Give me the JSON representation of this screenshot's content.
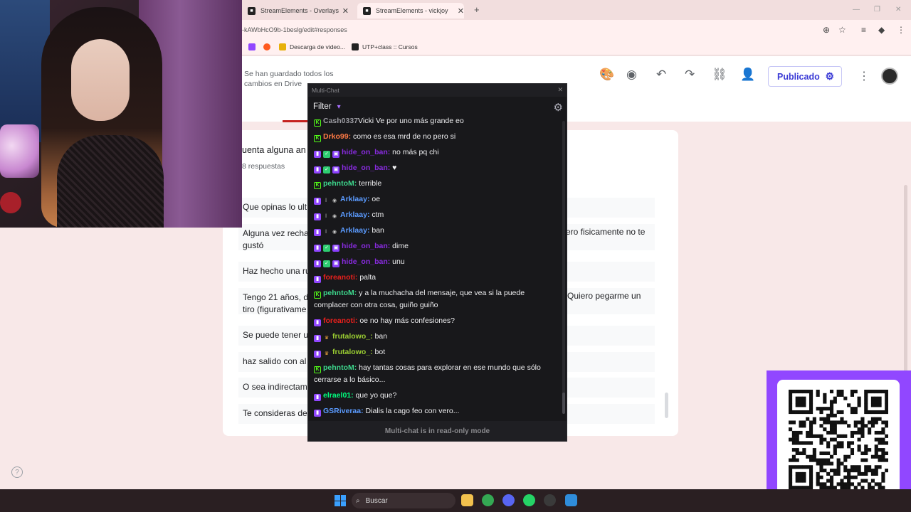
{
  "browser": {
    "tabs": [
      {
        "title": "StreamElements - Overlays"
      },
      {
        "title": "StreamElements - vickjoy"
      }
    ],
    "new_tab_symbol": "+",
    "url": "-kAWbHcO9b-1beslg/edit#responses",
    "bookmarks": [
      {
        "label": "",
        "icon": "twitch-icon",
        "color": "#9147ff"
      },
      {
        "label": "",
        "icon": "chrome-icon",
        "color": "#ff5a1f"
      },
      {
        "label": "Descarga de video...",
        "icon": "v-icon",
        "color": "#e7b10a"
      },
      {
        "label": "UTP+class :: Cursos",
        "icon": "utp-icon",
        "color": "#222222"
      }
    ]
  },
  "forms": {
    "saved_status": "Se han guardado todos los cambios en Drive",
    "publish_label": "Publicado",
    "question_title": "uenta alguna an",
    "responses_count": "8 respuestas",
    "responses": [
      {
        "left": "Que opinas lo ult",
        "right": ""
      },
      {
        "left": "Alguna vez recha",
        "right": "ero fisicamente no te",
        "continuation": "gustó"
      },
      {
        "left": "Haz hecho una ru",
        "right": ""
      },
      {
        "left": "Tengo 21 años, d",
        "right": "Quiero pegarme un",
        "continuation": "tiro (figurativame"
      },
      {
        "left": "Se puede tener u",
        "right": ""
      },
      {
        "left": "haz salido con al",
        "right": ""
      },
      {
        "left": "O sea indirectam",
        "right": ""
      },
      {
        "left": "Te consideras de",
        "right": ""
      }
    ]
  },
  "multichat": {
    "window_title": "Multi-Chat",
    "filter_label": "Filter",
    "footer": "Multi-chat is in read-only mode",
    "messages": [
      {
        "platform": "kick",
        "badges": [],
        "user": "Cash0337",
        "user_color": "#9a9aa0",
        "text": "Vicki Ve por uno más grande eo"
      },
      {
        "platform": "kick",
        "badges": [],
        "user": "Drko99:",
        "user_color": "#ff7a45",
        "text": " como es esa mrd de no pero si"
      },
      {
        "platform": "twitch",
        "badges": [
          "green",
          "purple"
        ],
        "user": "hide_on_ban:",
        "user_color": "#8a2be2",
        "text": " no más pq chi"
      },
      {
        "platform": "twitch",
        "badges": [
          "green",
          "purple"
        ],
        "user": "hide_on_ban:",
        "user_color": "#8a2be2",
        "text": " ♥"
      },
      {
        "platform": "kick",
        "badges": [],
        "user": "pehntoM:",
        "user_color": "#3dd68c",
        "text": " terrible"
      },
      {
        "platform": "twitch",
        "badges": [
          "sword",
          "bot"
        ],
        "user": "Arklaay:",
        "user_color": "#5b9bff",
        "text": " oe"
      },
      {
        "platform": "twitch",
        "badges": [
          "sword",
          "bot"
        ],
        "user": "Arklaay:",
        "user_color": "#5b9bff",
        "text": " ctm"
      },
      {
        "platform": "twitch",
        "badges": [
          "sword",
          "bot"
        ],
        "user": "Arklaay:",
        "user_color": "#5b9bff",
        "text": " ban"
      },
      {
        "platform": "twitch",
        "badges": [
          "green",
          "purple"
        ],
        "user": "hide_on_ban:",
        "user_color": "#8a2be2",
        "text": " dime"
      },
      {
        "platform": "twitch",
        "badges": [
          "green",
          "purple"
        ],
        "user": "hide_on_ban:",
        "user_color": "#8a2be2",
        "text": " unu"
      },
      {
        "platform": "twitch",
        "badges": [],
        "user": "foreanoti:",
        "user_color": "#e8201c",
        "text": " palta"
      },
      {
        "platform": "kick",
        "badges": [],
        "user": "pehntoM:",
        "user_color": "#3dd68c",
        "text": " y a la muchacha del mensaje, que vea si la puede complacer con otra cosa, guiño guiño"
      },
      {
        "platform": "twitch",
        "badges": [],
        "user": "foreanoti:",
        "user_color": "#e8201c",
        "text": " oe no hay más confesiones?"
      },
      {
        "platform": "twitch",
        "badges": [
          "crown"
        ],
        "user": "frutalowo_:",
        "user_color": "#9acd32",
        "text": " ban"
      },
      {
        "platform": "twitch",
        "badges": [
          "crown"
        ],
        "user": "frutalowo_:",
        "user_color": "#9acd32",
        "text": " bot"
      },
      {
        "platform": "kick",
        "badges": [],
        "user": "pehntoM:",
        "user_color": "#3dd68c",
        "text": " hay tantas cosas para explorar en ese mundo que sólo cerrarse a lo básico..."
      },
      {
        "platform": "twitch",
        "badges": [],
        "user": "elrael01:",
        "user_color": "#00ff7f",
        "text": " que yo que?"
      },
      {
        "platform": "twitch",
        "badges": [],
        "user": "GSRiveraa:",
        "user_color": "#5b9bff",
        "text": " Dialis la cago feo con vero..."
      }
    ]
  },
  "taskbar": {
    "search_label": "Buscar",
    "apps": [
      {
        "name": "file-explorer-icon",
        "color": "#f2c14e"
      },
      {
        "name": "chrome-icon",
        "color": "#34a853"
      },
      {
        "name": "discord-icon",
        "color": "#5865f2"
      },
      {
        "name": "whatsapp-icon",
        "color": "#25d366"
      },
      {
        "name": "obs-icon",
        "color": "#3a3a3a"
      },
      {
        "name": "app-icon",
        "color": "#2f8ddb"
      }
    ]
  },
  "colors": {
    "twitch_purple": "#9147ff",
    "kick_green": "#53fc18",
    "publish_blue": "#3b3bd6"
  }
}
